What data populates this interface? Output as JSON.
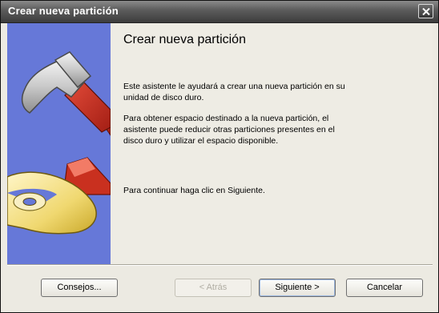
{
  "window": {
    "title": "Crear nueva partición"
  },
  "content": {
    "heading": "Crear nueva partición",
    "paragraph1": "Este asistente le ayudará a crear una nueva partición en su unidad de disco duro.",
    "paragraph2": "Para obtener espacio destinado a la nueva partición, el asistente puede reducir otras particiones presentes en el disco duro y utilizar el espacio disponible.",
    "paragraph3": "Para continuar haga clic en Siguiente."
  },
  "buttons": {
    "tips": "Consejos...",
    "back": "< Atrás",
    "next": "Siguiente >",
    "cancel": "Cancelar"
  },
  "colors": {
    "side_panel": "#6678d8",
    "titlebar": "#4a4a4a",
    "dialog_background": "#eceae2"
  },
  "icons": {
    "side_illustration": "hammer-disk-partition-icon",
    "close": "close-icon"
  }
}
